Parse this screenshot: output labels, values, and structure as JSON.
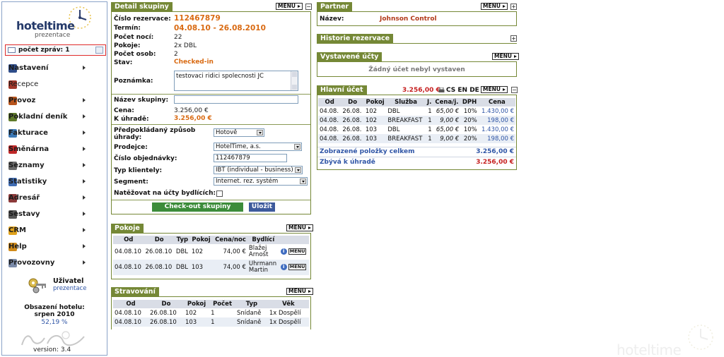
{
  "sidebar": {
    "logo_text": "hoteltime",
    "logo_sub": "prezentace",
    "messages": "počet zpráv: 1",
    "menu": [
      {
        "label": "Nastavení",
        "arrow": true,
        "color": "#2f4d8a"
      },
      {
        "label": "Recepce",
        "arrow": false,
        "color": "#a2372a"
      },
      {
        "label": "Provoz",
        "arrow": true,
        "color": "#b7541c"
      },
      {
        "label": "Pokladní deník",
        "arrow": true,
        "color": "#5f7a2a"
      },
      {
        "label": "Fakturace",
        "arrow": true,
        "color": "#3b78b5"
      },
      {
        "label": "Směnárna",
        "arrow": true,
        "color": "#c02828"
      },
      {
        "label": "Seznamy",
        "arrow": true,
        "color": "#6a6a6a"
      },
      {
        "label": "Statistiky",
        "arrow": true,
        "color": "#3f6cb3"
      },
      {
        "label": "Adresář",
        "arrow": true,
        "color": "#8c3a3a"
      },
      {
        "label": "Sestavy",
        "arrow": true,
        "color": "#555555"
      },
      {
        "label": "CRM",
        "arrow": true,
        "color": "#e0a21c"
      },
      {
        "label": "Help",
        "arrow": true,
        "color": "#d18b1a"
      },
      {
        "label": "Provozovny",
        "arrow": true,
        "color": "#7a8aa8"
      }
    ],
    "user_label": "Uživatel",
    "user_org": "prezentace",
    "occupancy_title": "Obsazení hotelu:",
    "occupancy_month": "srpen 2010",
    "occupancy_value": "52,19 %",
    "version": "version: 3.4"
  },
  "detail": {
    "title": "Detail skupiny",
    "menu_label": "MENU",
    "collapse": "−",
    "reservation_label": "Číslo rezervace:",
    "reservation_value": "112467879",
    "term_label": "Termín:",
    "term_value": "04.08.10 - 26.08.2010",
    "nights_label": "Počet nocí:",
    "nights_value": "22",
    "rooms_label": "Pokoje:",
    "rooms_value": "2x DBL",
    "persons_label": "Počet osob:",
    "persons_value": "2",
    "state_label": "Stav:",
    "state_value": "Checked-in",
    "note_label": "Poznámka:",
    "note_value": "testovaci ridici spolecnosti JC",
    "group_name_label": "Název skupiny:",
    "group_name_value": "",
    "price_label": "Cena:",
    "price_value": "3.256,00 €",
    "topay_label": "K úhradě:",
    "topay_value": "3.256,00 €",
    "payment_label": "Předpokládaný způsob úhrady:",
    "payment_value": "Hotově",
    "seller_label": "Prodejce:",
    "seller_value": "HotelTime, a.s.",
    "order_label": "Číslo objednávky:",
    "order_value": "112467879",
    "clientele_label": "Typ klientely:",
    "clientele_value": "IBT (individual - business)",
    "segment_label": "Segment:",
    "segment_value": "Internet. rez. systém",
    "charge_label": "Natěžovat na účty bydlících:",
    "checkout_button": "Check-out skupiny",
    "save_button": "Uložit"
  },
  "rooms": {
    "title": "Pokoje",
    "menu_label": "MENU",
    "headers": [
      "Od",
      "Do",
      "Typ",
      "Pokoj",
      "Cena/noc",
      "Bydlící"
    ],
    "rows": [
      {
        "od": "04.08.10",
        "do": "26.08.10",
        "typ": "DBL",
        "pokoj": "102",
        "cena": "74,00 €",
        "bydlici1": "Blažej",
        "bydlici2": "Arnošt"
      },
      {
        "od": "04.08.10",
        "do": "26.08.10",
        "typ": "DBL",
        "pokoj": "103",
        "cena": "74,00 €",
        "bydlici1": "Uhrmann",
        "bydlici2": "Martin"
      }
    ],
    "row_menu": "MENU",
    "info": "i"
  },
  "boarding": {
    "title": "Stravování",
    "menu_label": "MENU",
    "headers": [
      "Od",
      "Do",
      "Pokoj",
      "Počet",
      "Typ",
      "Věk"
    ],
    "rows": [
      {
        "od": "04.08.10",
        "do": "26.08.10",
        "pokoj": "102",
        "pocet": "1",
        "typ": "Snídaně",
        "vek": "1x Dospělí"
      },
      {
        "od": "04.08.10",
        "do": "26.08.10",
        "pokoj": "103",
        "pocet": "1",
        "typ": "Snídaně",
        "vek": "1x Dospělí"
      }
    ]
  },
  "partner": {
    "title": "Partner",
    "menu_label": "MENU",
    "expand": "+",
    "name_label": "Název:",
    "name_value": "Johnson Control"
  },
  "history": {
    "title": "Historie rezervace",
    "expand": "+"
  },
  "issued": {
    "title": "Vystavené účty",
    "menu_label": "MENU",
    "empty_text": "Žádný účet nebyl vystaven"
  },
  "main_account": {
    "title": "Hlavní účet",
    "total": "3.256,00 €",
    "langs": "CS EN DE",
    "menu_label": "MENU",
    "collapse": "−",
    "headers": [
      "Od",
      "Do",
      "Pokoj",
      "Služba",
      "J.",
      "Cena/j.",
      "DPH",
      "Cena"
    ],
    "rows": [
      {
        "od": "04.08.",
        "do": "26.08.",
        "pokoj": "102",
        "sluzba": "DBL",
        "j": "1",
        "cenaj": "65,00 €",
        "dph": "10%",
        "cena": "1.430,00 €"
      },
      {
        "od": "04.08.",
        "do": "26.08.",
        "pokoj": "102",
        "sluzba": "BREAKFAST",
        "j": "1",
        "cenaj": "9,00 €",
        "dph": "20%",
        "cena": "198,00 €"
      },
      {
        "od": "04.08.",
        "do": "26.08.",
        "pokoj": "103",
        "sluzba": "DBL",
        "j": "1",
        "cenaj": "65,00 €",
        "dph": "10%",
        "cena": "1.430,00 €"
      },
      {
        "od": "04.08.",
        "do": "26.08.",
        "pokoj": "103",
        "sluzba": "BREAKFAST",
        "j": "1",
        "cenaj": "9,00 €",
        "dph": "20%",
        "cena": "198,00 €"
      }
    ],
    "shown_total_label": "Zobrazené položky celkem",
    "shown_total_value": "3.256,00 €",
    "remaining_label": "Zbývá k úhradě",
    "remaining_value": "3.256,00 €"
  },
  "watermark": "hoteltime"
}
